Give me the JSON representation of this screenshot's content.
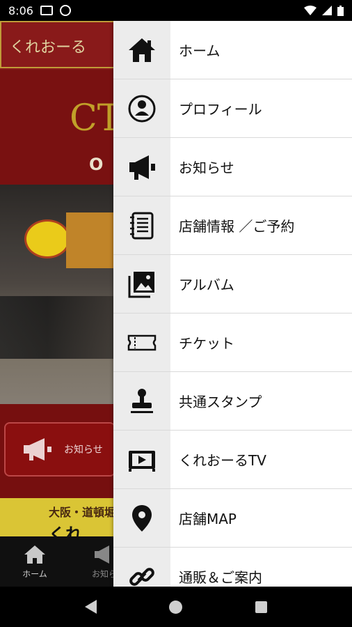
{
  "status_bar": {
    "time": "8:06"
  },
  "app": {
    "title": "くれおーる",
    "banner_logo": "CT",
    "banner_sub": "O",
    "news_button": "お知らせ",
    "promo_line1": "大阪・道頓堀",
    "promo_line2": "くれ",
    "bottom_tabs": [
      {
        "label": "ホーム"
      },
      {
        "label": "お知ら"
      }
    ]
  },
  "drawer": {
    "items": [
      {
        "label": "ホーム",
        "icon": "home-icon"
      },
      {
        "label": "プロフィール",
        "icon": "profile-icon"
      },
      {
        "label": "お知らせ",
        "icon": "megaphone-icon"
      },
      {
        "label": "店舗情報 ／ご予約",
        "icon": "notebook-icon"
      },
      {
        "label": "アルバム",
        "icon": "album-icon"
      },
      {
        "label": "チケット",
        "icon": "ticket-icon"
      },
      {
        "label": "共通スタンプ",
        "icon": "stamp-icon"
      },
      {
        "label": "くれおーるTV",
        "icon": "tv-icon"
      },
      {
        "label": "店舗MAP",
        "icon": "map-pin-icon"
      },
      {
        "label": "通販＆ご案内",
        "icon": "link-icon"
      }
    ]
  },
  "colors": {
    "app_background": "#7a1010",
    "drawer_icon_cell": "#ececec",
    "promo_yellow": "#e2cc37"
  }
}
